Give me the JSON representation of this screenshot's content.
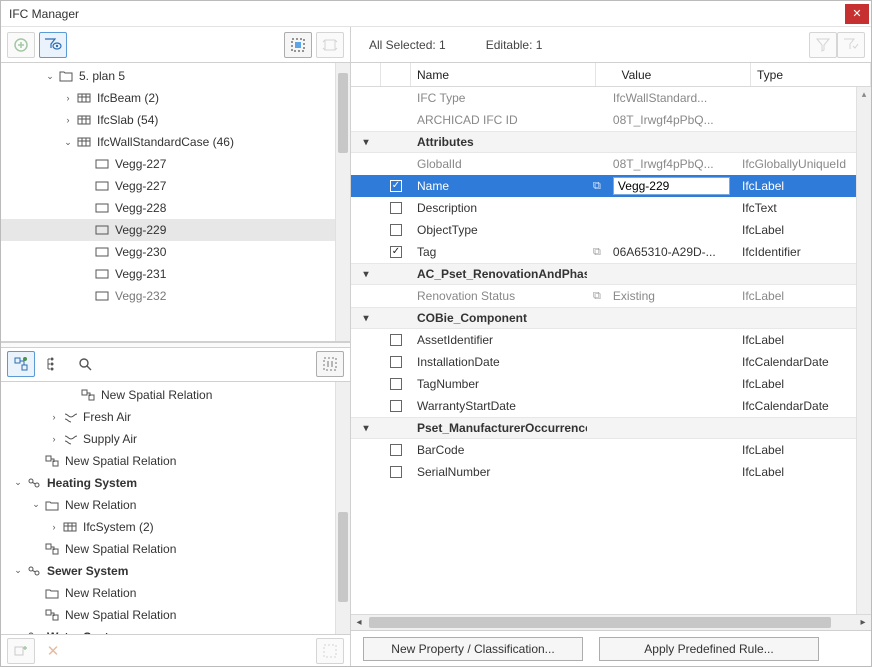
{
  "window_title": "IFC Manager",
  "left": {
    "tree_top": [
      {
        "depth": 1,
        "expander": "down",
        "icon": "folder",
        "label": "5. plan 5"
      },
      {
        "depth": 2,
        "expander": "right",
        "icon": "element",
        "label": "IfcBeam (2)"
      },
      {
        "depth": 2,
        "expander": "right",
        "icon": "element",
        "label": "IfcSlab (54)"
      },
      {
        "depth": 2,
        "expander": "down",
        "icon": "element",
        "label": "IfcWallStandardCase (46)"
      },
      {
        "depth": 3,
        "expander": "",
        "icon": "wall",
        "label": "Vegg-227"
      },
      {
        "depth": 3,
        "expander": "",
        "icon": "wall",
        "label": "Vegg-227"
      },
      {
        "depth": 3,
        "expander": "",
        "icon": "wall",
        "label": "Vegg-228"
      },
      {
        "depth": 3,
        "expander": "",
        "icon": "wall",
        "label": "Vegg-229",
        "selected": true
      },
      {
        "depth": 3,
        "expander": "",
        "icon": "wall",
        "label": "Vegg-230"
      },
      {
        "depth": 3,
        "expander": "",
        "icon": "wall",
        "label": "Vegg-231"
      },
      {
        "depth": 3,
        "expander": "",
        "icon": "wall",
        "label": "Vegg-232",
        "muted": true
      }
    ],
    "tree_bottom": [
      {
        "depth": 3,
        "expander": "",
        "icon": "relation",
        "label": "New Spatial Relation"
      },
      {
        "depth": 2,
        "expander": "right",
        "icon": "air",
        "label": "Fresh Air"
      },
      {
        "depth": 2,
        "expander": "right",
        "icon": "air",
        "label": "Supply Air"
      },
      {
        "depth": 1,
        "expander": "",
        "icon": "relation",
        "label": "New Spatial Relation"
      },
      {
        "depth": 0,
        "expander": "down",
        "icon": "system",
        "label": "Heating System",
        "bold": true
      },
      {
        "depth": 1,
        "expander": "down",
        "icon": "folderrel",
        "label": "New Relation"
      },
      {
        "depth": 2,
        "expander": "right",
        "icon": "element",
        "label": "IfcSystem (2)"
      },
      {
        "depth": 1,
        "expander": "",
        "icon": "relation",
        "label": "New Spatial Relation"
      },
      {
        "depth": 0,
        "expander": "down",
        "icon": "system",
        "label": "Sewer System",
        "bold": true
      },
      {
        "depth": 1,
        "expander": "",
        "icon": "folderrel",
        "label": "New Relation"
      },
      {
        "depth": 1,
        "expander": "",
        "icon": "relation",
        "label": "New Spatial Relation"
      },
      {
        "depth": 0,
        "expander": "right",
        "icon": "system",
        "label": "Water System",
        "bold": true
      }
    ]
  },
  "right": {
    "summary_selected": "All Selected: 1",
    "summary_editable": "Editable: 1",
    "columns": {
      "name": "Name",
      "value": "Value",
      "type": "Type"
    },
    "rows": [
      {
        "kind": "prop",
        "muted": true,
        "name": "IFC Type",
        "value": "IfcWallStandard...",
        "type": ""
      },
      {
        "kind": "prop",
        "muted": true,
        "name": "ARCHICAD IFC ID",
        "value": "08T_Irwgf4pPbQ...",
        "type": ""
      },
      {
        "kind": "group",
        "name": "Attributes"
      },
      {
        "kind": "prop",
        "muted": true,
        "name": "GlobalId",
        "value": "08T_Irwgf4pPbQ...",
        "type": "IfcGloballyUniqueId"
      },
      {
        "kind": "prop",
        "selected": true,
        "checked": true,
        "link": true,
        "name": "Name",
        "value": "Vegg-229",
        "type": "IfcLabel"
      },
      {
        "kind": "prop",
        "checked": false,
        "name": "Description",
        "value": "",
        "type": "IfcText"
      },
      {
        "kind": "prop",
        "checked": false,
        "name": "ObjectType",
        "value": "",
        "type": "IfcLabel"
      },
      {
        "kind": "prop",
        "checked": true,
        "link": true,
        "name": "Tag",
        "value": "06A65310-A29D-...",
        "type": "IfcIdentifier"
      },
      {
        "kind": "group",
        "name": "AC_Pset_RenovationAndPhasing"
      },
      {
        "kind": "prop",
        "muted": true,
        "link": true,
        "name": "Renovation Status",
        "value": "Existing",
        "type": "IfcLabel"
      },
      {
        "kind": "group",
        "name": "COBie_Component"
      },
      {
        "kind": "prop",
        "checked": false,
        "name": "AssetIdentifier",
        "value": "",
        "type": "IfcLabel"
      },
      {
        "kind": "prop",
        "checked": false,
        "name": "InstallationDate",
        "value": "",
        "type": "IfcCalendarDate"
      },
      {
        "kind": "prop",
        "checked": false,
        "name": "TagNumber",
        "value": "",
        "type": "IfcLabel"
      },
      {
        "kind": "prop",
        "checked": false,
        "name": "WarrantyStartDate",
        "value": "",
        "type": "IfcCalendarDate"
      },
      {
        "kind": "group",
        "name": "Pset_ManufacturerOccurrence"
      },
      {
        "kind": "prop",
        "checked": false,
        "name": "BarCode",
        "value": "",
        "type": "IfcLabel"
      },
      {
        "kind": "prop",
        "checked": false,
        "name": "SerialNumber",
        "value": "",
        "type": "IfcLabel"
      }
    ],
    "footer": {
      "new_property": "New Property / Classification...",
      "apply_rule": "Apply Predefined Rule..."
    }
  }
}
